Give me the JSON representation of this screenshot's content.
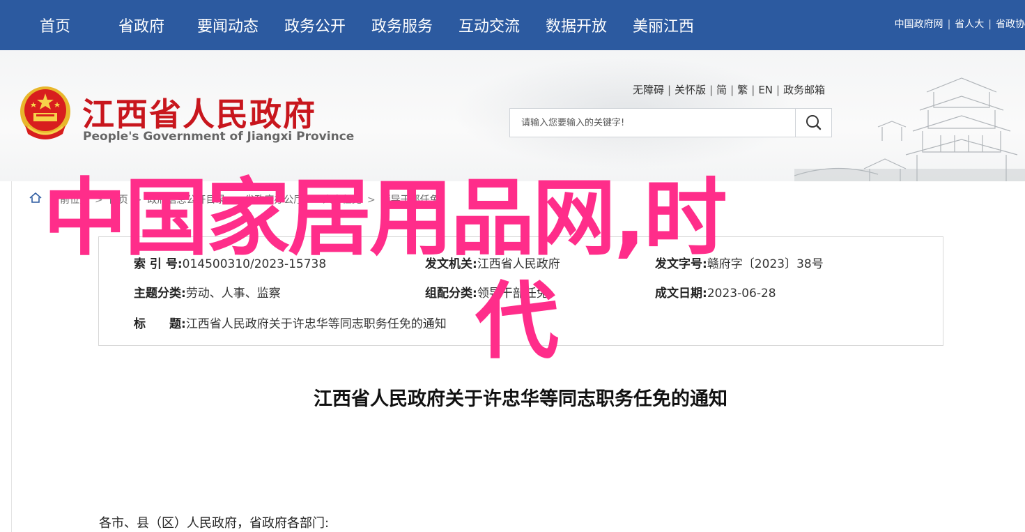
{
  "nav": {
    "items": [
      "首页",
      "省政府",
      "要闻动态",
      "政务公开",
      "政务服务",
      "互动交流",
      "数据开放",
      "美丽江西"
    ],
    "top_links": [
      "中国政府网",
      "省人大",
      "省政协"
    ]
  },
  "header": {
    "title": "江西省人民政府",
    "subtitle": "People's Government of Jiangxi Province",
    "util_links": [
      "无障碍",
      "关怀版",
      "简",
      "繁",
      "EN",
      "政务邮箱"
    ],
    "search_placeholder": "请输入您要输入的关键字!"
  },
  "breadcrumb": [
    "当前位置",
    "首页",
    "政府信息公开目录",
    "省政府办公厅",
    "人事任免",
    "领导干部任免"
  ],
  "meta": {
    "index_label": "索 引 号:",
    "index_value": "014500310/2023-15738",
    "issuer_label": "发文机关:",
    "issuer_value": "江西省人民政府",
    "docno_label": "发文字号:",
    "docno_value": "赣府字〔2023〕38号",
    "category_label": "主题分类:",
    "category_value": "劳动、人事、监察",
    "group_label": "组配分类:",
    "group_value": "领导干部任免",
    "date_label": "成文日期:",
    "date_value": "2023-06-28",
    "title_label": "标　　题:",
    "title_value": "江西省人民政府关于许忠华等同志职务任免的通知"
  },
  "article": {
    "title": "江西省人民政府关于许忠华等同志职务任免的通知",
    "greeting": "各市、县（区）人民政府，省政府各部门:"
  },
  "overlay": {
    "line1": "中国家居用品网,时",
    "line2": "代"
  },
  "colors": {
    "nav_bg": "#2c5aa0",
    "brand_red": "#c8161d",
    "overlay_pink": "#ff2d8a"
  }
}
